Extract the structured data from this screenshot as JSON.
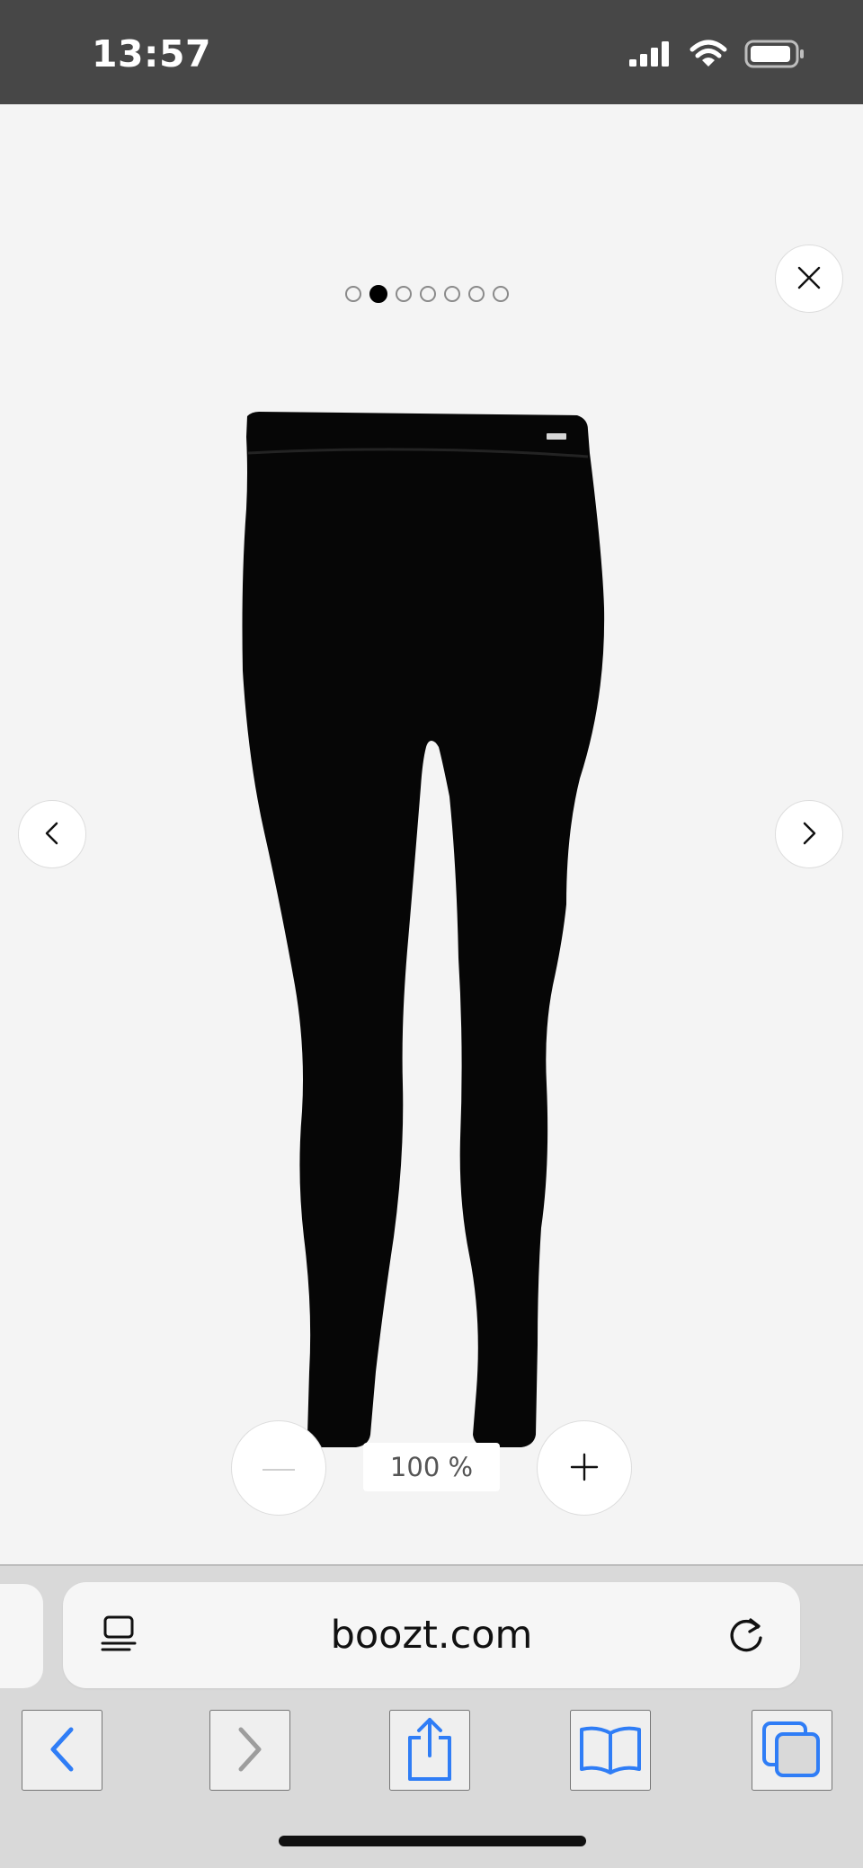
{
  "status_bar": {
    "time": "13:57"
  },
  "viewer": {
    "image_count": 7,
    "active_image_index": 1,
    "close_label": "Close",
    "prev_label": "Previous image",
    "next_label": "Next image",
    "zoom": {
      "value": "100 %"
    }
  },
  "browser": {
    "url": "boozt.com"
  },
  "icons": {
    "close": "close-icon",
    "prev": "chevron-left-icon",
    "next": "chevron-right-icon",
    "zoom_out": "minus-icon",
    "zoom_in": "plus-icon",
    "reader": "reader-mode-icon",
    "reload": "reload-icon",
    "back": "back-icon",
    "forward": "forward-icon",
    "share": "share-icon",
    "bookmarks": "bookmarks-icon",
    "tabs": "tabs-icon"
  },
  "colors": {
    "status_bar_bg": "#474747",
    "viewer_bg": "#f4f4f4",
    "browser_bg": "#d9d9d9",
    "accent": "#2f7df6",
    "disabled": "#9d9d9d"
  }
}
